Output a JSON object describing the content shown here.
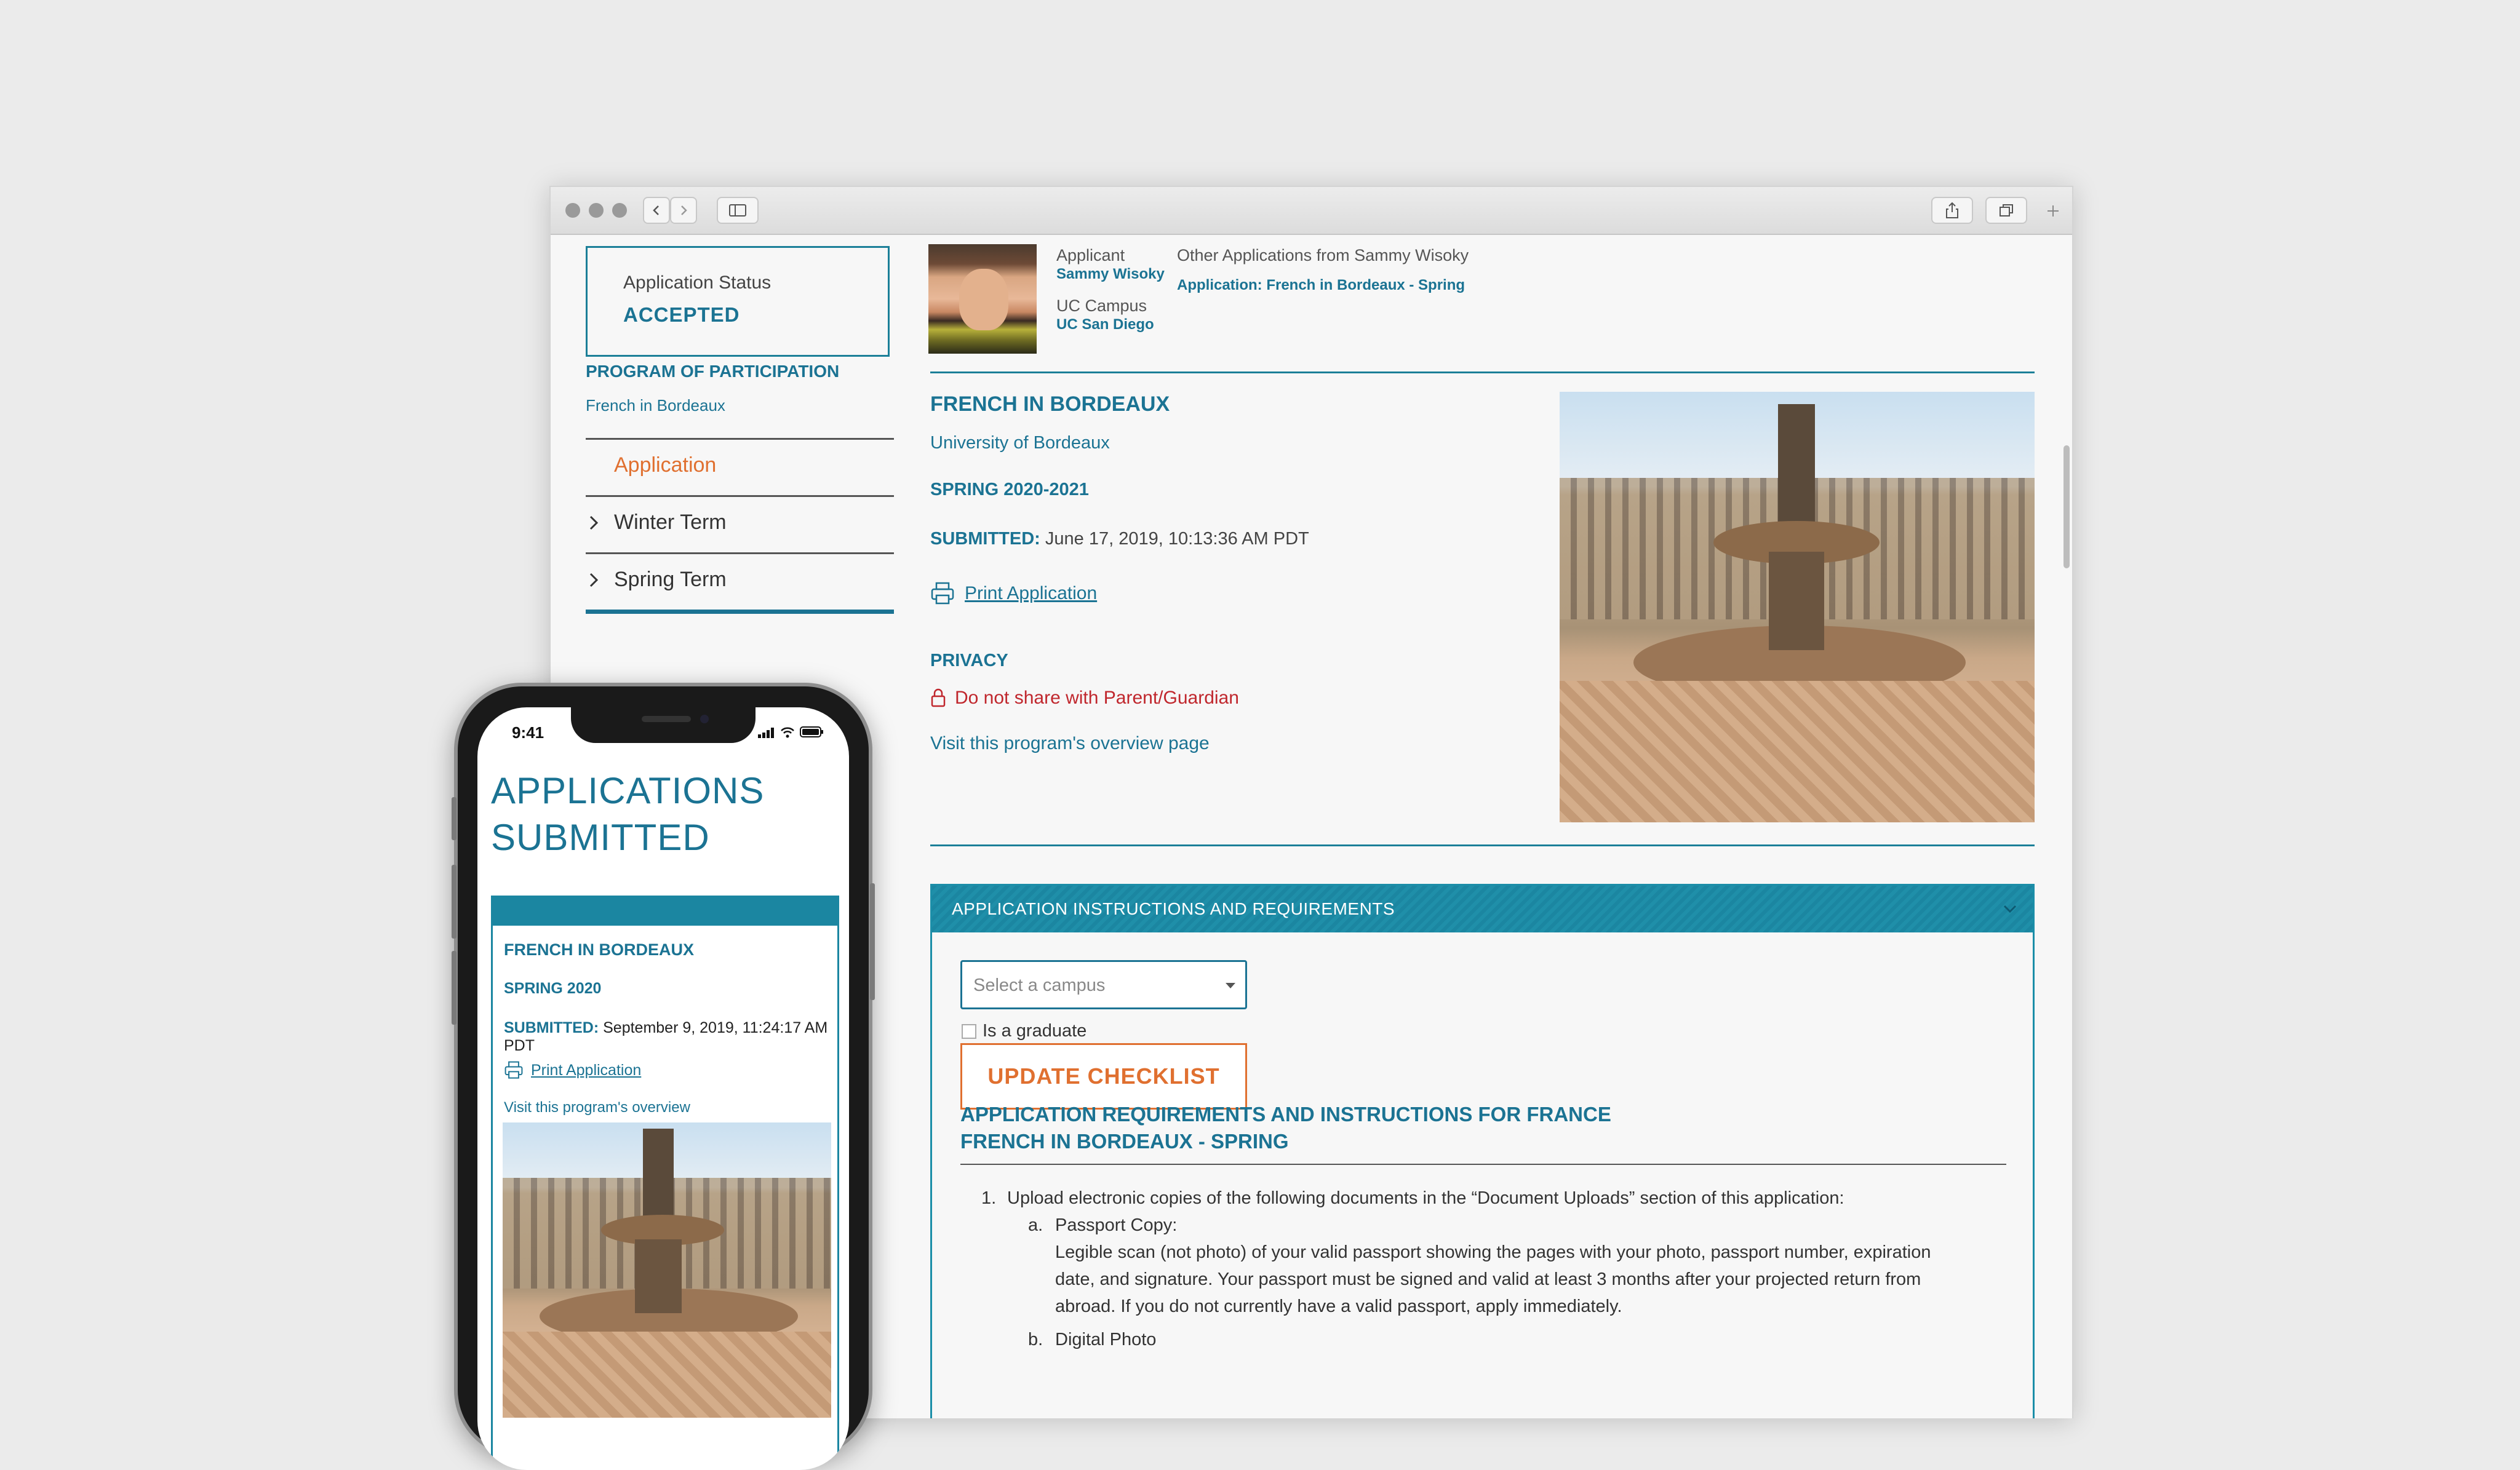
{
  "sidebar": {
    "status_label": "Application Status",
    "status_value": "ACCEPTED",
    "program_label": "PROGRAM OF PARTICIPATION",
    "program_value": "French in Bordeaux",
    "nav": [
      {
        "label": "Application",
        "active": true
      },
      {
        "label": "Winter Term",
        "active": false
      },
      {
        "label": "Spring Term",
        "active": false
      }
    ]
  },
  "applicant": {
    "label": "Applicant",
    "name": "Sammy Wisoky",
    "campus_label": "UC Campus",
    "campus": "UC San Diego",
    "other_label": "Other Applications from Sammy Wisoky",
    "other_link": "Application: French in Bordeaux - Spring"
  },
  "program": {
    "title": "FRENCH IN BORDEAUX",
    "university": "University of Bordeaux",
    "term": "SPRING 2020-2021",
    "submitted_label": "SUBMITTED:",
    "submitted_value": "June 17, 2019, 10:13:36 AM PDT",
    "print_label": "Print Application",
    "privacy_label": "PRIVACY",
    "privacy_value": "Do not share with Parent/Guardian",
    "visit_label": "Visit this program's overview page"
  },
  "requirements": {
    "header": "APPLICATION INSTRUCTIONS AND REQUIREMENTS",
    "campus_placeholder": "Select a campus",
    "graduate_label": "Is a graduate",
    "update_button": "UPDATE CHECKLIST",
    "title_line1": "APPLICATION REQUIREMENTS AND INSTRUCTIONS FOR FRANCE",
    "title_line2": "FRENCH IN BORDEAUX - SPRING",
    "item1_num": "1.",
    "item1_text": "Upload electronic copies of the following documents in the “Document Uploads” section of this application:",
    "item1a_num": "a.",
    "item1a_title": "Passport Copy:",
    "item1a_text1": "Legible scan (not photo) of your valid passport showing the pages with your photo, passport number, expiration",
    "item1a_text2": "date, and signature. Your passport must be signed and valid at least 3 months after your projected return from",
    "item1a_text3": "abroad. If you do not currently have a valid passport, apply immediately.",
    "item1b_num": "b.",
    "item1b_title": "Digital Photo"
  },
  "mobile": {
    "time": "9:41",
    "title_line1": "APPLICATIONS",
    "title_line2": "SUBMITTED",
    "program": "FRENCH IN BORDEAUX",
    "term": "SPRING 2020",
    "submitted_label": "SUBMITTED:",
    "submitted_value": "September 9, 2019, 11:24:17 AM PDT",
    "print_label": "Print Application",
    "visit_label": "Visit this program's overview"
  },
  "colors": {
    "primary": "#1b7393",
    "accent": "#e07030",
    "danger": "#c0272d",
    "header_bar": "#1b86a1"
  },
  "icons": [
    "back-icon",
    "forward-icon",
    "sidebar-icon",
    "share-icon",
    "tabs-icon",
    "new-tab-icon",
    "chevron-right-icon",
    "printer-icon",
    "lock-icon",
    "chevron-down-icon",
    "cursor-hand-icon"
  ]
}
